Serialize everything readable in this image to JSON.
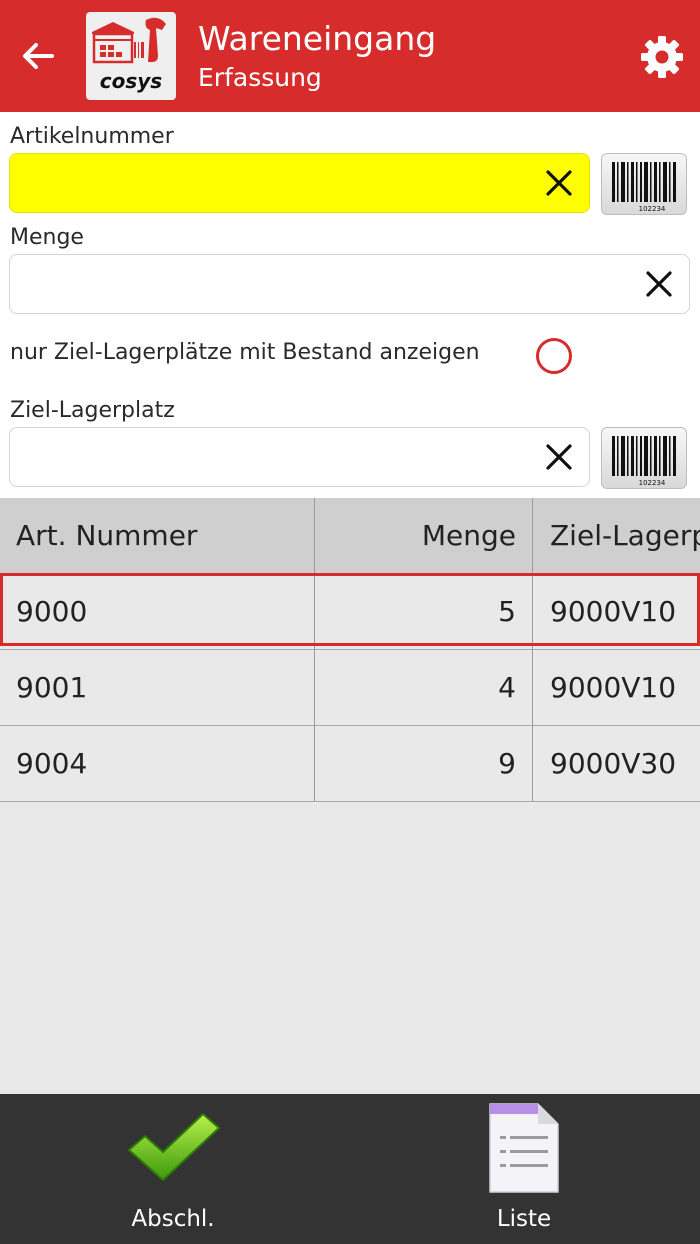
{
  "header": {
    "title": "Wareneingang",
    "subtitle": "Erfassung",
    "back_icon": "arrow-left-icon",
    "settings_icon": "gear-icon",
    "bar_color": "#d62c2c"
  },
  "form": {
    "artikelnummer": {
      "label": "Artikelnummer",
      "value": ""
    },
    "menge": {
      "label": "Menge",
      "value": ""
    },
    "only_with_stock": {
      "label": "nur Ziel-Lagerplätze mit Bestand anzeigen",
      "checked": false
    },
    "ziel_lagerplatz": {
      "label": "Ziel-Lagerplatz",
      "value": ""
    },
    "barcode_number": "102234"
  },
  "table": {
    "headers": [
      "Art. Nummer",
      "Menge",
      "Ziel-Lagerp"
    ],
    "rows": [
      {
        "artnr": "9000",
        "menge": "5",
        "ziel": "9000V10"
      },
      {
        "artnr": "9001",
        "menge": "4",
        "ziel": "9000V10"
      },
      {
        "artnr": "9004",
        "menge": "9",
        "ziel": "9000V30"
      }
    ],
    "selected_row": 0
  },
  "bottom": {
    "finish_label": "Abschl.",
    "list_label": "Liste"
  }
}
